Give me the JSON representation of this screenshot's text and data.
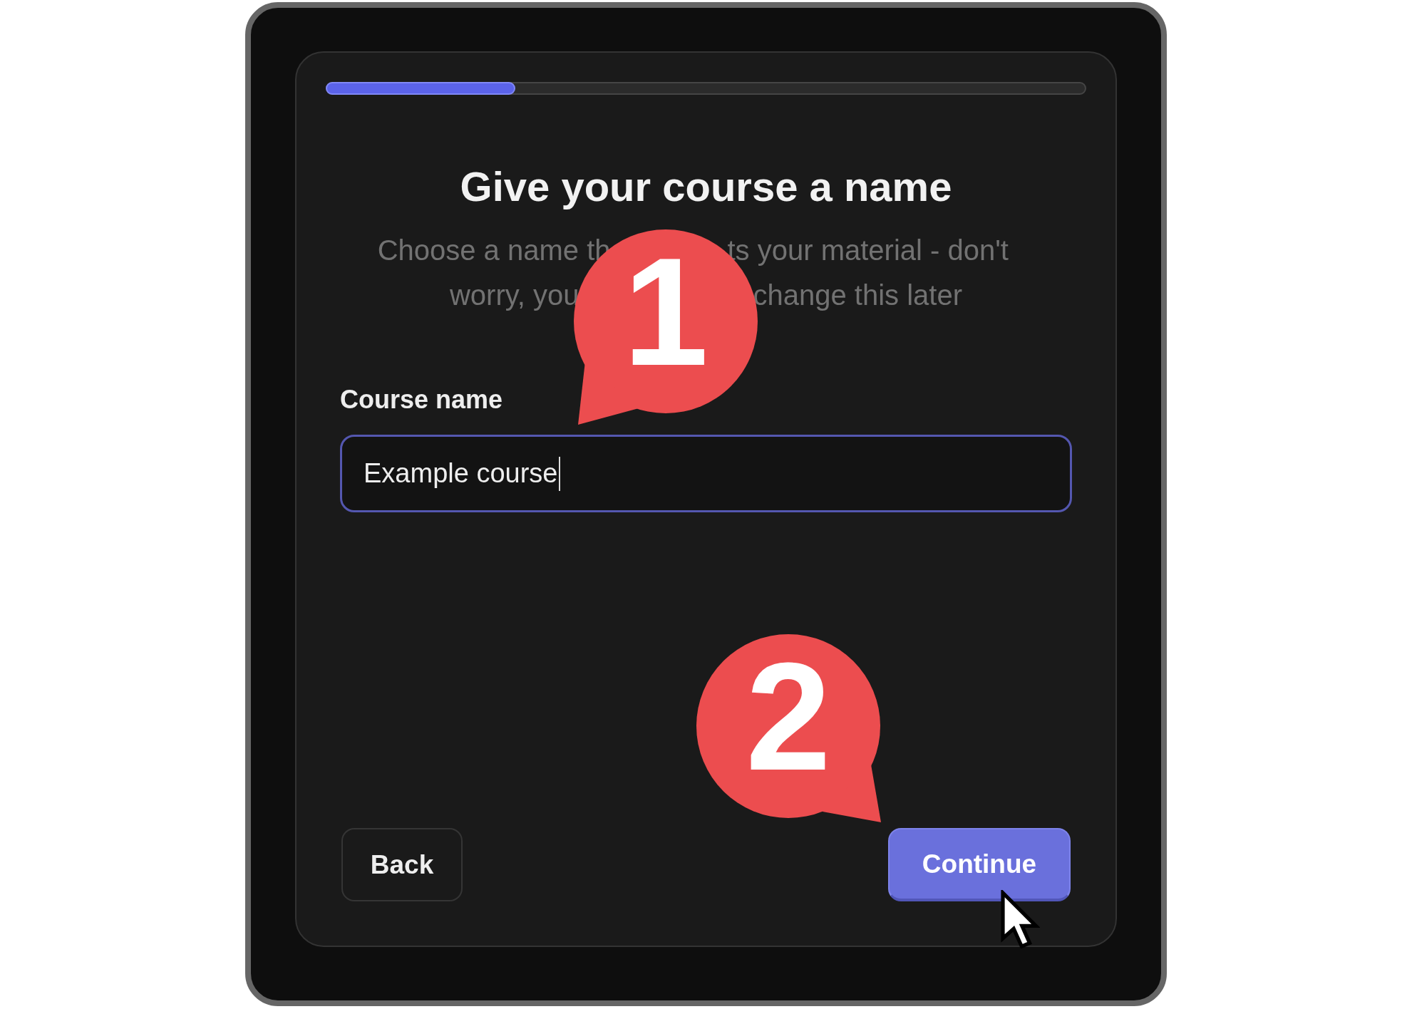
{
  "progress": {
    "level": 0.25
  },
  "title": "Give your course a name",
  "subtitle_lines": [
    {
      "left": "Choose a name th",
      "right": "ts your material - don't"
    },
    {
      "left": "worry, you",
      "right": "change this later"
    }
  ],
  "field": {
    "label": "Course name",
    "value": "Example course",
    "focused": true
  },
  "buttons": [
    {
      "label": "Back",
      "kind": "secondary"
    },
    {
      "label": "Continue",
      "kind": "primary"
    }
  ],
  "callouts": [
    {
      "number": "1"
    },
    {
      "number": "2"
    }
  ]
}
